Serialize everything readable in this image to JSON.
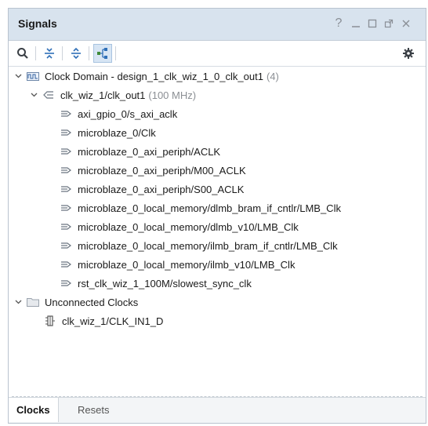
{
  "panel": {
    "title": "Signals",
    "window_controls": [
      "help-icon",
      "minimize-icon",
      "maximize-icon",
      "float-icon",
      "close-icon"
    ]
  },
  "toolbar": {
    "buttons": [
      "search-icon",
      "collapse-all-icon",
      "expand-all-icon",
      "show-hierarchy-icon",
      "settings-icon"
    ]
  },
  "tree": {
    "clock_domain": {
      "label": "Clock Domain - design_1_clk_wiz_1_0_clk_out1",
      "count": "(4)"
    },
    "clock": {
      "label": "clk_wiz_1/clk_out1",
      "freq": "(100 MHz)"
    },
    "signals": [
      "axi_gpio_0/s_axi_aclk",
      "microblaze_0/Clk",
      "microblaze_0_axi_periph/ACLK",
      "microblaze_0_axi_periph/M00_ACLK",
      "microblaze_0_axi_periph/S00_ACLK",
      "microblaze_0_local_memory/dlmb_bram_if_cntlr/LMB_Clk",
      "microblaze_0_local_memory/dlmb_v10/LMB_Clk",
      "microblaze_0_local_memory/ilmb_bram_if_cntlr/LMB_Clk",
      "microblaze_0_local_memory/ilmb_v10/LMB_Clk",
      "rst_clk_wiz_1_100M/slowest_sync_clk"
    ],
    "unconnected": {
      "label": "Unconnected Clocks",
      "items": [
        "clk_wiz_1/CLK_IN1_D"
      ]
    }
  },
  "tabs": {
    "clocks": "Clocks",
    "resets": "Resets",
    "active": "Clocks"
  },
  "colors": {
    "header_bg": "#d8e3ee",
    "selected_toggle_bg": "#d7e5f4",
    "muted_text": "#8b8f94",
    "icon_gray": "#6b7580"
  }
}
